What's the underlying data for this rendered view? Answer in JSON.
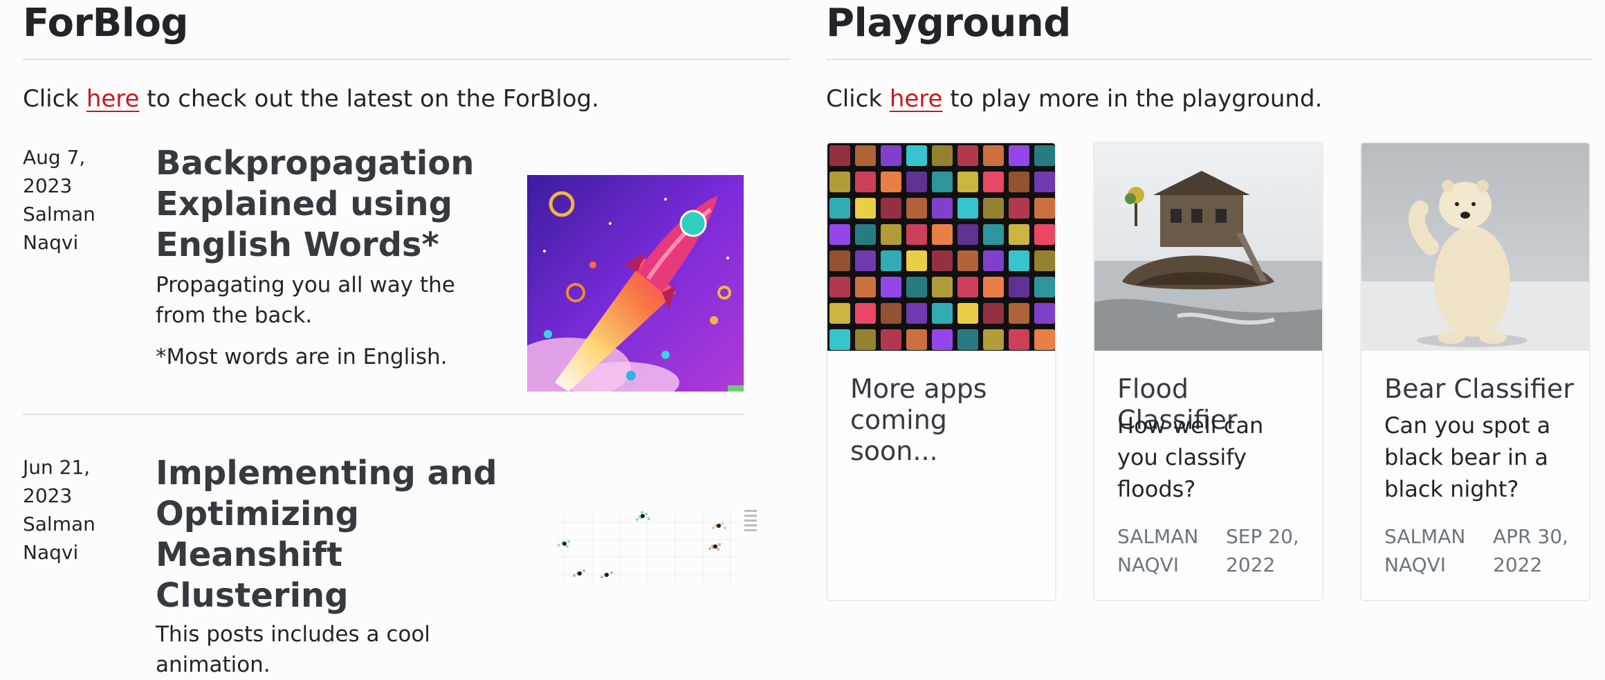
{
  "blog": {
    "title": "ForBlog",
    "intro_prefix": "Click",
    "intro_link": "here",
    "intro_suffix": "to check out the latest on the ForBlog.",
    "posts": [
      {
        "date": "Aug 7, 2023",
        "author": "Salman Naqvi",
        "title": "Backpropagation Explained using English Words*",
        "description": "Propagating you all way the from the back.",
        "note": "*Most words are in English."
      },
      {
        "date": "Jun 21, 2023",
        "author": "Salman Naqvi",
        "title": "Implementing and Optimizing Meanshift Clustering",
        "description": "This posts includes a cool animation."
      }
    ]
  },
  "playground": {
    "title": "Playground",
    "intro_prefix": "Click",
    "intro_link": "here",
    "intro_suffix": "to play more in the playground.",
    "cards": [
      {
        "title": "More apps coming soon..."
      },
      {
        "title": "Flood Classifier",
        "description": "How well can you classify floods?",
        "author": "SALMAN NAQVI",
        "date": "SEP 20, 2022"
      },
      {
        "title": "Bear Classifier",
        "description": "Can you spot a black bear in a black night?",
        "author": "SALMAN NAQVI",
        "date": "APR 30, 2022"
      }
    ]
  },
  "colors": {
    "link": "#c9171e",
    "heading": "#343a40",
    "muted": "#6c757d",
    "divider": "#e1e3e6"
  }
}
